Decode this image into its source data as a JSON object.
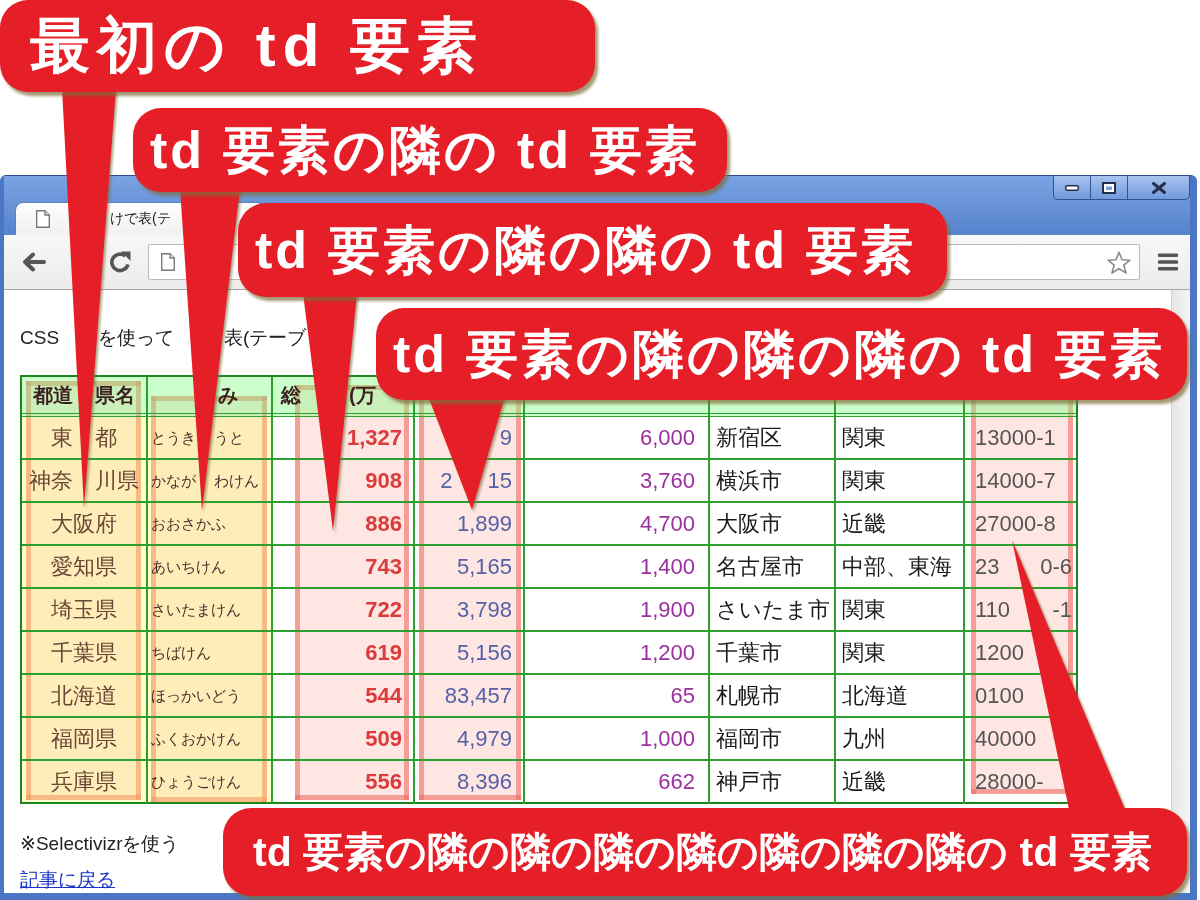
{
  "window": {
    "tab": {
      "title_parts": [
        "けで表(テ"
      ]
    },
    "page": {
      "intro_parts": [
        "CSS",
        "を使って",
        "表(テーブ"
      ],
      "table": {
        "columns": [
          {
            "heading_parts": [
              "都道",
              "県名"
            ],
            "highlighted": true
          },
          {
            "heading_parts": [
              "み"
            ],
            "highlighted": true
          },
          {
            "heading_parts": [
              "総",
              "(万"
            ],
            "highlighted": true
          },
          {
            "highlighted": true
          },
          {
            "highlighted": false
          },
          {
            "highlighted": false
          },
          {
            "highlighted": false
          },
          {
            "highlighted": true
          }
        ],
        "rows": [
          {
            "cells": [
              [
                "東",
                "都"
              ],
              [
                "とうき",
                "うと"
              ],
              [
                "1,327"
              ],
              [
                "9"
              ],
              [
                "6,000"
              ],
              [
                "新宿区"
              ],
              [
                "関東"
              ],
              [
                "13000-1"
              ]
            ]
          },
          {
            "cells": [
              [
                "神奈",
                "川県"
              ],
              [
                "かなが",
                "わけん"
              ],
              [
                "908"
              ],
              [
                "2",
                "15"
              ],
              [
                "3,760"
              ],
              [
                "横浜市"
              ],
              [
                "関東"
              ],
              [
                "14000-7"
              ]
            ]
          },
          {
            "cells": [
              [
                "大阪府"
              ],
              [
                "おおさかふ"
              ],
              [
                "886"
              ],
              [
                "1,899"
              ],
              [
                "4,700"
              ],
              [
                "大阪市"
              ],
              [
                "近畿"
              ],
              [
                "27000-8"
              ]
            ]
          },
          {
            "cells": [
              [
                "愛知県"
              ],
              [
                "あいちけん"
              ],
              [
                "743"
              ],
              [
                "5,165"
              ],
              [
                "1,400"
              ],
              [
                "名古屋市"
              ],
              [
                "中部、東海"
              ],
              [
                "23",
                "0-6"
              ]
            ]
          },
          {
            "cells": [
              [
                "埼玉県"
              ],
              [
                "さいたまけん"
              ],
              [
                "722"
              ],
              [
                "3,798"
              ],
              [
                "1,900"
              ],
              [
                "さいたま市"
              ],
              [
                "関東"
              ],
              [
                "110",
                "-1"
              ]
            ]
          },
          {
            "cells": [
              [
                "千葉県"
              ],
              [
                "ちばけん"
              ],
              [
                "619"
              ],
              [
                "5,156"
              ],
              [
                "1,200"
              ],
              [
                "千葉市"
              ],
              [
                "関東"
              ],
              [
                "1200"
              ]
            ]
          },
          {
            "cells": [
              [
                "北海道"
              ],
              [
                "ほっかいどう"
              ],
              [
                "544"
              ],
              [
                "83,457"
              ],
              [
                "65"
              ],
              [
                "札幌市"
              ],
              [
                "北海道"
              ],
              [
                "0100"
              ]
            ]
          },
          {
            "cells": [
              [
                "福岡県"
              ],
              [
                "ふくおかけん"
              ],
              [
                "509"
              ],
              [
                "4,979"
              ],
              [
                "1,000"
              ],
              [
                "福岡市"
              ],
              [
                "九州"
              ],
              [
                "40000"
              ]
            ]
          },
          {
            "cells": [
              [
                "兵庫県"
              ],
              [
                "ひょうごけん"
              ],
              [
                "556"
              ],
              [
                "8,396"
              ],
              [
                "662"
              ],
              [
                "神戸市"
              ],
              [
                "近畿"
              ],
              [
                "28000-"
              ]
            ]
          }
        ]
      },
      "note": "※Selectivizrを使う",
      "back_link": "記事に戻る"
    }
  },
  "callouts": [
    {
      "text": "最初の td 要素"
    },
    {
      "text": "td 要素の隣の td 要素"
    },
    {
      "text": "td 要素の隣の隣の td 要素"
    },
    {
      "text": "td 要素の隣の隣の隣の td 要素"
    },
    {
      "text": "td 要素の隣の隣の隣の隣の隣の隣の隣の td 要素"
    }
  ]
}
